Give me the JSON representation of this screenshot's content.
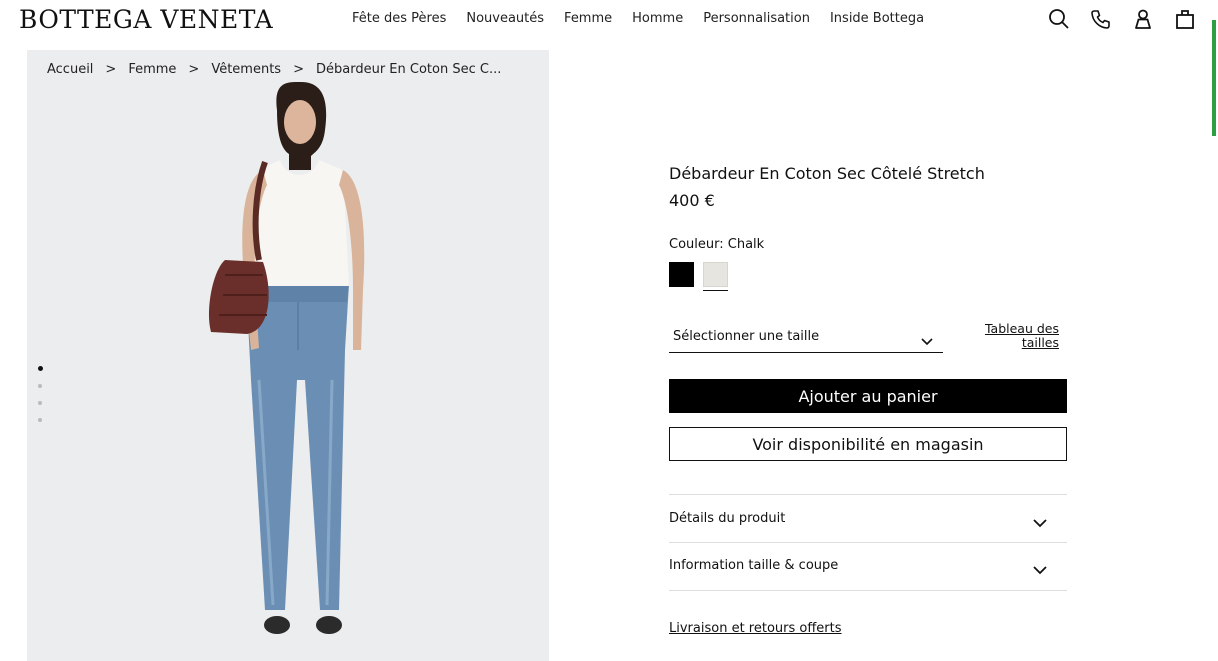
{
  "brand": "BOTTEGA VENETA",
  "nav": [
    "Fête des Pères",
    "Nouveautés",
    "Femme",
    "Homme",
    "Personnalisation",
    "Inside Bottega"
  ],
  "header_icons": [
    "search-icon",
    "phone-icon",
    "account-icon",
    "bag-icon"
  ],
  "breadcrumb": [
    "Accueil",
    "Femme",
    "Vêtements",
    "Débardeur En Coton Sec C..."
  ],
  "breadcrumb_separator": ">",
  "gallery": {
    "image_count": 4,
    "active_index": 0
  },
  "product": {
    "name": "Débardeur En Coton Sec Côtelé Stretch",
    "price": "400 €",
    "color_label": "Couleur: Chalk",
    "swatches": [
      {
        "name": "Black",
        "hex": "#000000"
      },
      {
        "name": "Chalk",
        "hex": "#e6e5df",
        "selected": true
      }
    ]
  },
  "size_select": {
    "placeholder": "Sélectionner une taille"
  },
  "size_guide": {
    "line1": "Tableau des",
    "line2": "tailles"
  },
  "buttons": {
    "add_to_cart": "Ajouter au panier",
    "store_availability": "Voir disponibilité en magasin"
  },
  "accordions": [
    "Détails du produit",
    "Information taille & coupe"
  ],
  "delivery_link": "Livraison et retours offerts",
  "colors": {
    "accent_bar": "#2e9e43",
    "image_background": "#ecedee"
  }
}
